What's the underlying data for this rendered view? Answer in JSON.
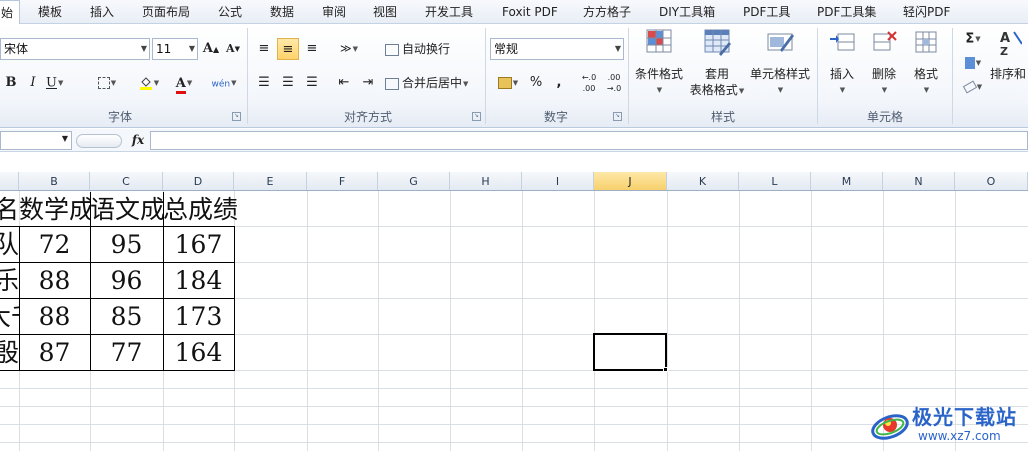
{
  "tabs": [
    "始",
    "模板",
    "插入",
    "页面布局",
    "公式",
    "数据",
    "审阅",
    "视图",
    "开发工具",
    "Foxit PDF",
    "方方格子",
    "DIY工具箱",
    "PDF工具",
    "PDF工具集",
    "轻闪PDF"
  ],
  "font_group": {
    "label": "字体",
    "font_name": "宋体",
    "font_size": "11",
    "grow_label": "A",
    "shrink_label": "A",
    "bold": "B",
    "italic": "I",
    "underline": "U",
    "font_color_letter": "A",
    "phonetic": "wén"
  },
  "align_group": {
    "label": "对齐方式",
    "wrap_text": "自动换行",
    "merge_center": "合并后居中"
  },
  "number_group": {
    "label": "数字",
    "format": "常规",
    "percent": "%",
    "comma": ",",
    "inc_decimal": "←.0 .00",
    "dec_decimal": ".00 →.0"
  },
  "styles_group": {
    "label": "样式",
    "conditional": "条件格式",
    "table_format_line1": "套用",
    "table_format_line2": "表格格式",
    "cell_styles": "单元格样式"
  },
  "cells_group": {
    "label": "单元格",
    "insert": "插入",
    "delete": "删除",
    "format": "格式"
  },
  "editing_group": {
    "sigma": "Σ",
    "sort_filter": "排序和"
  },
  "formula_bar": {
    "fx": "fx",
    "name": "",
    "content": ""
  },
  "columns": [
    "B",
    "C",
    "D",
    "E",
    "F",
    "G",
    "H",
    "I",
    "J",
    "K",
    "L",
    "M",
    "N",
    "O"
  ],
  "active_column": "J",
  "sheet": {
    "header": [
      "名",
      "数学成绩",
      "语文成绩",
      "总成绩"
    ],
    "rows": [
      [
        "队",
        "72",
        "95",
        "167"
      ],
      [
        "乐",
        "88",
        "96",
        "184"
      ],
      [
        "大千",
        "88",
        "85",
        "173"
      ],
      [
        "殷",
        "87",
        "77",
        "164"
      ]
    ]
  },
  "watermark": {
    "title": "极光下载站",
    "url": "www.xz7.com"
  }
}
